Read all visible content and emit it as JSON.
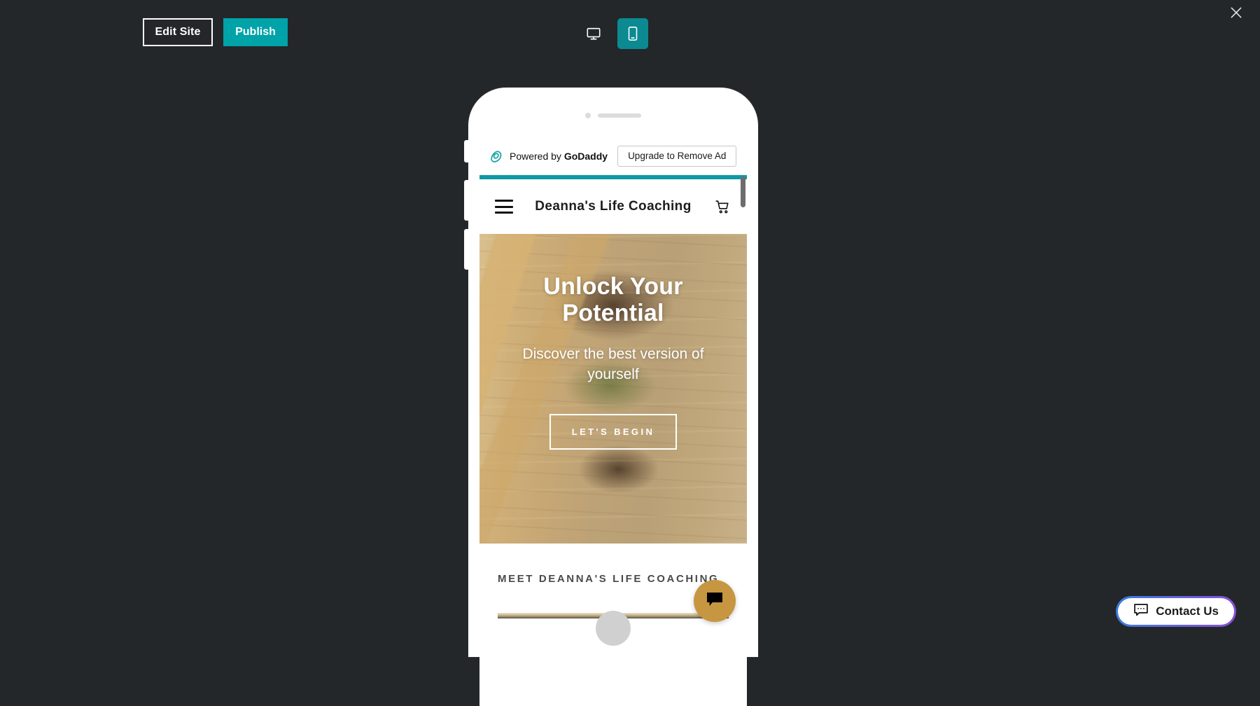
{
  "toolbar": {
    "edit_site_label": "Edit Site",
    "publish_label": "Publish",
    "desktop_icon": "desktop-monitor-icon",
    "mobile_icon": "mobile-phone-icon",
    "active_device": "mobile",
    "close_icon": "close-x-icon",
    "accent_color": "#00a3a8",
    "background_color": "#23272a"
  },
  "preview": {
    "ad_bar": {
      "logo_icon": "godaddy-logo-icon",
      "powered_prefix": "Powered by ",
      "brand": "GoDaddy",
      "upgrade_label": "Upgrade to Remove Ad"
    },
    "accent_bar_color": "#0c9aa6",
    "site_header": {
      "menu_icon": "hamburger-menu-icon",
      "title": "Deanna's Life Coaching",
      "cart_icon": "shopping-cart-icon"
    },
    "hero": {
      "title": "Unlock Your Potential",
      "subtitle": "Discover the best version of yourself",
      "cta_label": "LET'S BEGIN"
    },
    "sections": [
      {
        "title": "MEET DEANNA'S LIFE COACHING"
      }
    ],
    "chat_fab": {
      "icon": "chat-bubble-icon",
      "color": "#c69640"
    },
    "scrollbar": {
      "position": "top"
    }
  },
  "contact_widget": {
    "label": "Contact Us",
    "icon": "chat-bubble-dots-icon",
    "border_gradient_from": "#3b7ddd",
    "border_gradient_to": "#8b4fd6"
  }
}
